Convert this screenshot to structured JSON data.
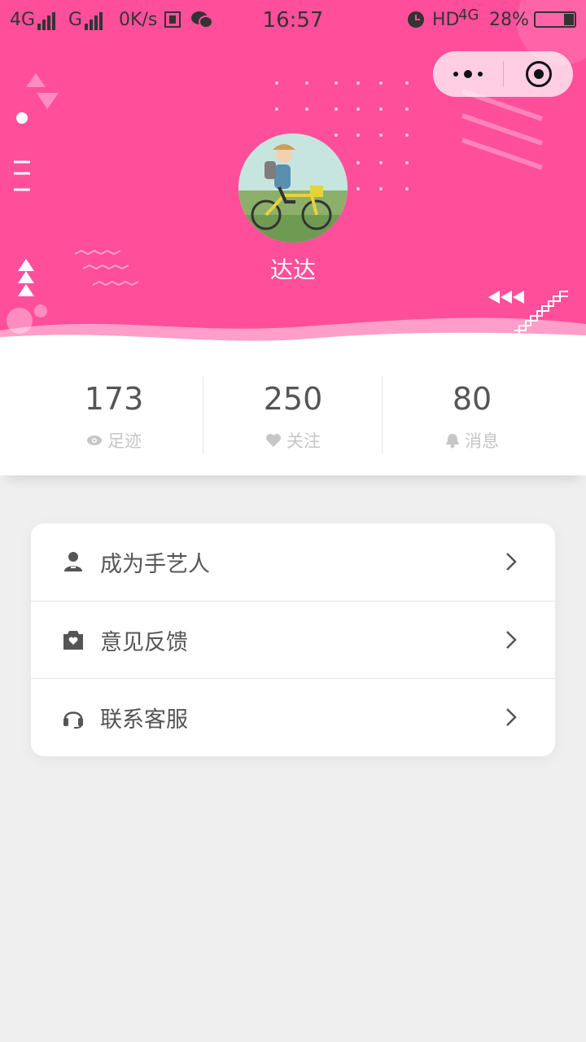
{
  "status_bar": {
    "network1": "4G",
    "network2": "G",
    "speed": "0K/s",
    "time": "16:57",
    "hd": "HD",
    "network3": "4G",
    "battery": "28%"
  },
  "profile": {
    "nickname": "达达"
  },
  "stats": [
    {
      "value": "173",
      "label": "足迹",
      "icon": "eye-icon"
    },
    {
      "value": "250",
      "label": "关注",
      "icon": "heart-icon"
    },
    {
      "value": "80",
      "label": "消息",
      "icon": "bell-icon"
    }
  ],
  "menu": [
    {
      "label": "成为手艺人",
      "icon": "user-icon"
    },
    {
      "label": "意见反馈",
      "icon": "feedback-icon"
    },
    {
      "label": "联系客服",
      "icon": "headset-icon"
    }
  ],
  "colors": {
    "header": "#ff4f9b",
    "background": "#efefef"
  }
}
